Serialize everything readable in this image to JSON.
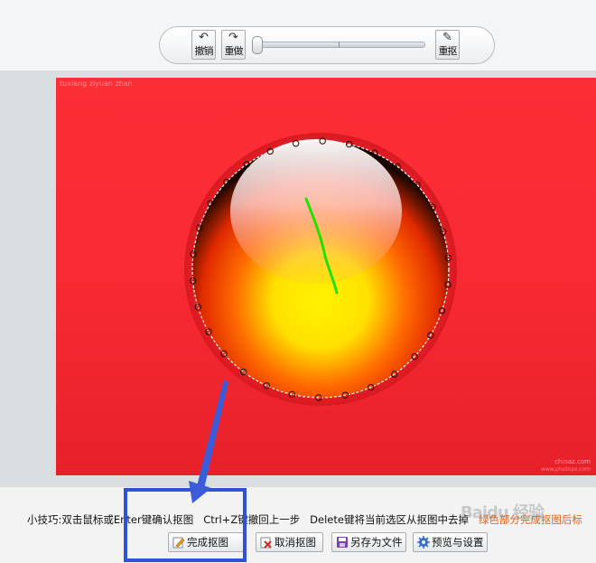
{
  "toolbar": {
    "undo_label": "撤销",
    "redo_label": "重做",
    "reset_label": "重抠"
  },
  "canvas": {
    "watermark_top": "tuxiang ziyuan zhan",
    "watermark_bottom_1": "chinaz.com",
    "watermark_bottom_2": "www.photops.com"
  },
  "tip": {
    "part1": "小技巧:双击鼠标或Enter键确认抠图",
    "part2": "Ctrl+Z键撤回上一步",
    "part3": "Delete键将当前选区从抠图中去掉",
    "part4": "绿色部分完成抠图后标"
  },
  "actions": {
    "done": "完成抠图",
    "cancel": "取消抠图",
    "save": "另存为文件",
    "preview": "预览与设置"
  },
  "overlay": {
    "baidu_watermark": "Baidu 经验"
  },
  "colors": {
    "highlight": "#2f52d6",
    "stroke": "#22e000",
    "canvas_red": "#f82a33"
  }
}
